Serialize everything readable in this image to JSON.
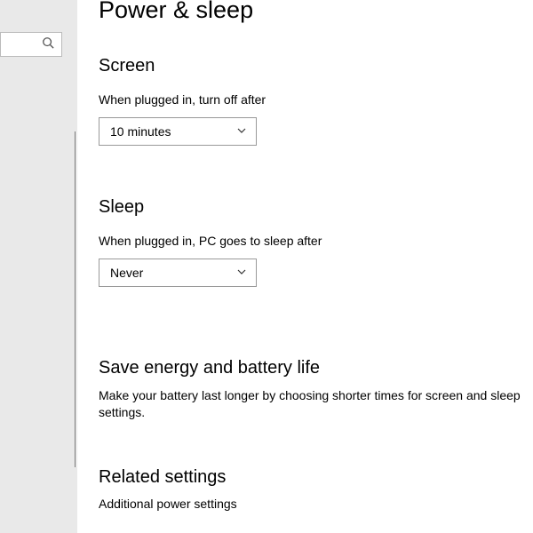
{
  "page": {
    "title": "Power & sleep"
  },
  "search": {
    "placeholder": ""
  },
  "screen": {
    "heading": "Screen",
    "pluggedInLabel": "When plugged in, turn off after",
    "pluggedInValue": "10 minutes"
  },
  "sleep": {
    "heading": "Sleep",
    "pluggedInLabel": "When plugged in, PC goes to sleep after",
    "pluggedInValue": "Never"
  },
  "energy": {
    "heading": "Save energy and battery life",
    "body": "Make your battery last longer by choosing shorter times for screen and sleep settings."
  },
  "related": {
    "heading": "Related settings",
    "links": [
      "Additional power settings"
    ]
  }
}
